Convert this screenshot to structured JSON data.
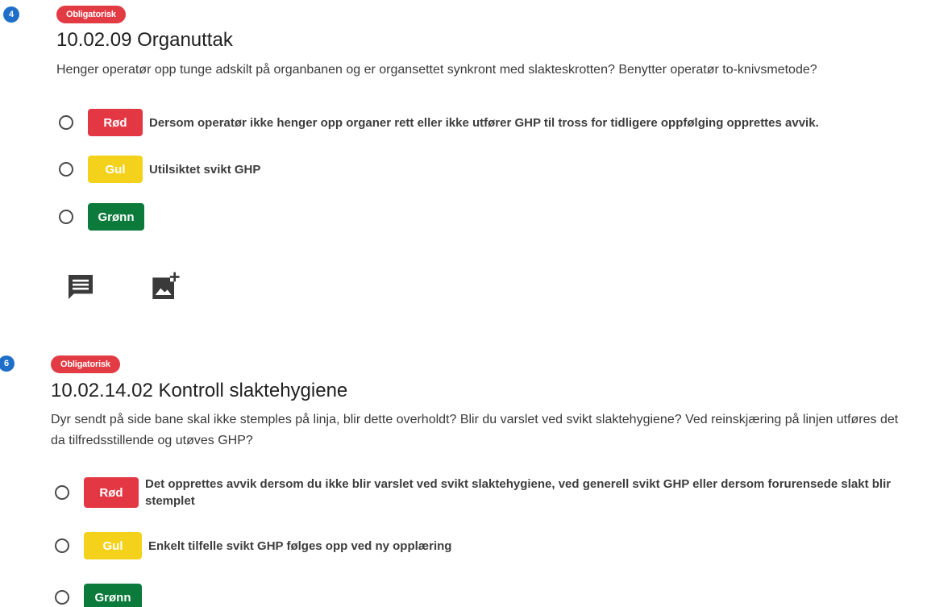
{
  "questions": [
    {
      "number": "4",
      "badge": "Obligatorisk",
      "title": "10.02.09 Organuttak",
      "description": "Henger operatør opp tunge adskilt på organbanen og er organsettet synkront med slakteskrotten? Benytter operatør to-knivsmetode?",
      "options": [
        {
          "color": "red",
          "label": "Rød",
          "text": "Dersom operatør ikke henger opp organer rett eller ikke utfører GHP til tross for tidligere oppfølging opprettes avvik."
        },
        {
          "color": "yellow",
          "label": "Gul",
          "text": "Utilsiktet svikt GHP"
        },
        {
          "color": "green",
          "label": "Grønn",
          "text": ""
        }
      ],
      "actions": {
        "comment_icon": "comment-icon",
        "add_image_icon": "add-photo-icon"
      }
    },
    {
      "number": "6",
      "badge": "Obligatorisk",
      "title": "10.02.14.02 Kontroll slaktehygiene",
      "description": "Dyr sendt på side bane skal ikke stemples på linja, blir dette overholdt? Blir du varslet ved svikt slaktehygiene? Ved reinskjæring på linjen utføres det da tilfredsstillende og utøves GHP?",
      "options": [
        {
          "color": "red",
          "label": "Rød",
          "text": "Det opprettes avvik dersom du ikke blir varslet ved svikt slaktehygiene, ved generell svikt GHP eller dersom forurensede slakt blir stemplet"
        },
        {
          "color": "yellow",
          "label": "Gul",
          "text": "Enkelt tilfelle svikt GHP følges opp ved ny opplæring"
        },
        {
          "color": "green",
          "label": "Grønn",
          "text": ""
        }
      ]
    }
  ],
  "colors": {
    "number_circle": "#1f6fc9",
    "badge": "#e23b44",
    "red": "#e33744",
    "yellow": "#f4d21c",
    "green": "#0b7a3b"
  }
}
